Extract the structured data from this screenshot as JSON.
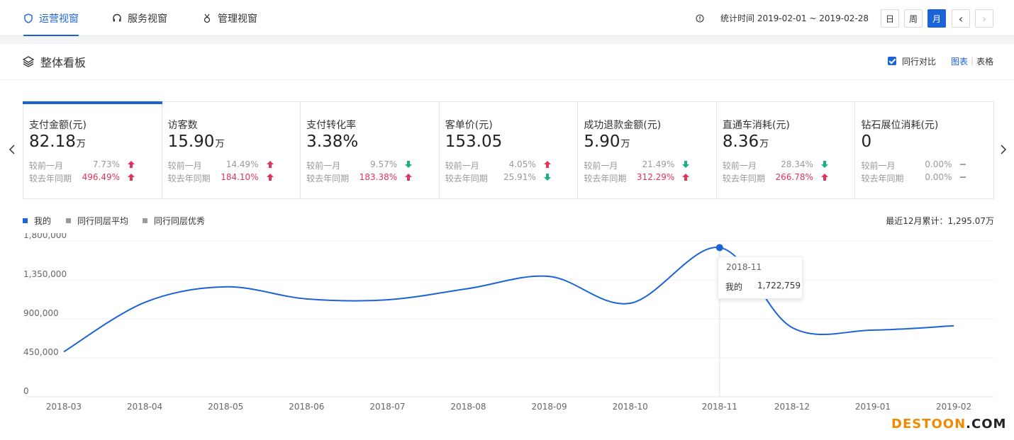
{
  "nav": {
    "tabs": [
      {
        "label": "运营视窗",
        "icon": "shield-icon",
        "active": true
      },
      {
        "label": "服务视窗",
        "icon": "headset-icon",
        "active": false
      },
      {
        "label": "管理视窗",
        "icon": "medal-icon",
        "active": false
      }
    ],
    "stat_time": "统计时间 2019-02-01 ~ 2019-02-28",
    "periods": [
      "日",
      "周",
      "月"
    ],
    "active_period": "月",
    "prev": "‹",
    "next": "›"
  },
  "panel": {
    "title": "整体看板",
    "compare_label": "同行对比",
    "view_chart": "图表",
    "view_sep": "|",
    "view_table": "表格"
  },
  "cards": [
    {
      "name": "支付金额(元)",
      "value": "82.18",
      "unit": "万",
      "mom_label": "较前一月",
      "mom": "7.73%",
      "mom_dir": "up",
      "yoy_label": "较去年同期",
      "yoy": "496.49%",
      "yoy_dir": "up"
    },
    {
      "name": "访客数",
      "value": "15.90",
      "unit": "万",
      "mom_label": "较前一月",
      "mom": "14.49%",
      "mom_dir": "up",
      "yoy_label": "较去年同期",
      "yoy": "184.10%",
      "yoy_dir": "up"
    },
    {
      "name": "支付转化率",
      "value": "3.38%",
      "unit": "",
      "mom_label": "较前一月",
      "mom": "9.57%",
      "mom_dir": "down",
      "yoy_label": "较去年同期",
      "yoy": "183.38%",
      "yoy_dir": "up"
    },
    {
      "name": "客单价(元)",
      "value": "153.05",
      "unit": "",
      "mom_label": "较前一月",
      "mom": "4.05%",
      "mom_dir": "up",
      "yoy_label": "较去年同期",
      "yoy": "25.91%",
      "yoy_dir": "down"
    },
    {
      "name": "成功退款金额(元)",
      "value": "5.90",
      "unit": "万",
      "mom_label": "较前一月",
      "mom": "21.49%",
      "mom_dir": "down",
      "yoy_label": "较去年同期",
      "yoy": "312.29%",
      "yoy_dir": "up"
    },
    {
      "name": "直通车消耗(元)",
      "value": "8.36",
      "unit": "万",
      "mom_label": "较前一月",
      "mom": "28.34%",
      "mom_dir": "down",
      "yoy_label": "较去年同期",
      "yoy": "266.78%",
      "yoy_dir": "up"
    },
    {
      "name": "钻石展位消耗(元)",
      "value": "0",
      "unit": "",
      "mom_label": "较前一月",
      "mom": "0.00%",
      "mom_dir": "flat",
      "yoy_label": "较去年同期",
      "yoy": "0.00%",
      "yoy_dir": "flat"
    }
  ],
  "legend": [
    {
      "label": "我的",
      "color": "#1c63d8"
    },
    {
      "label": "同行同层平均",
      "color": "#9a9a9a"
    },
    {
      "label": "同行同层优秀",
      "color": "#9a9a9a"
    }
  ],
  "summary": "最近12月累计：1,295.07万",
  "chart_data": {
    "type": "line",
    "categories": [
      "2018-03",
      "2018-04",
      "2018-05",
      "2018-06",
      "2018-07",
      "2018-08",
      "2018-09",
      "2018-10",
      "2018-11",
      "2018-12",
      "2019-01",
      "2019-02"
    ],
    "series": [
      {
        "name": "我的",
        "color": "#1c63d8",
        "values": [
          520000,
          1090000,
          1270000,
          1130000,
          1120000,
          1250000,
          1390000,
          1080000,
          1722759,
          800000,
          770000,
          820000
        ]
      }
    ],
    "yticks": [
      "1,800,000",
      "1,350,000",
      "900,000",
      "450,000",
      "0"
    ],
    "ylim": [
      0,
      1800000
    ],
    "grid": true,
    "tooltip": {
      "title": "2018-11",
      "label": "我的",
      "value": "1,722,759",
      "index": 8
    }
  },
  "brand": {
    "part1": "DESTOON",
    "part2": ".COM"
  }
}
